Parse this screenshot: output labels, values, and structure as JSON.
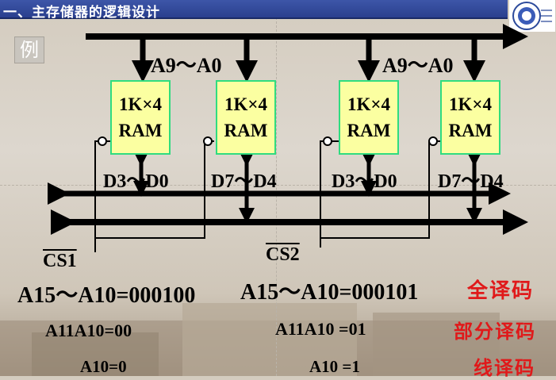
{
  "header": {
    "title": "一、主存储器的逻辑设计"
  },
  "example_label": "例",
  "chips": [
    {
      "line1": "1K×4",
      "line2": "RAM"
    },
    {
      "line1": "1K×4",
      "line2": "RAM"
    },
    {
      "line1": "1K×4",
      "line2": "RAM"
    },
    {
      "line1": "1K×4",
      "line2": "RAM"
    }
  ],
  "address_labels": [
    "A9～A0",
    "A9～A0"
  ],
  "data_labels": [
    "D3～D0",
    "D7～D4",
    "D3～D0",
    "D7～D4"
  ],
  "chip_selects": [
    "CS1",
    "CS2"
  ],
  "decode": {
    "full_left": "A15～A10=000100",
    "full_right": "A15～A10=000101",
    "partial_left": "A11A10=00",
    "partial_right": "A11A10 =01",
    "line_left": "A10=0",
    "line_right": "A10 =1"
  },
  "methods": {
    "full": "全译码",
    "partial": "部分译码",
    "line": "线译码"
  },
  "colors": {
    "title_bar": "#2e4494",
    "chip_fill": "#fbffa1",
    "chip_border": "#2fdc7f",
    "method_text": "#e0191a"
  }
}
